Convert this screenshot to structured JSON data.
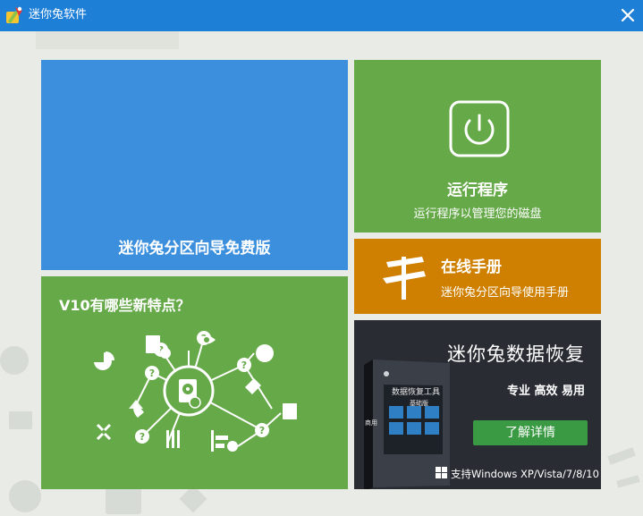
{
  "window": {
    "title": "迷你兔软件",
    "icon": "app-logo-icon",
    "close_icon": "close-icon"
  },
  "tiles": {
    "partition_wizard": {
      "title": "迷你兔分区向导免费版"
    },
    "features": {
      "title": "V10有哪些新特点？"
    },
    "run_program": {
      "title": "运行程序",
      "subtitle": "运行程序以管理您的磁盘",
      "icon": "power-icon"
    },
    "manual": {
      "title": "在线手册",
      "subtitle": "迷你兔分区向导使用手册",
      "icon": "signpost-icon"
    },
    "promo": {
      "title": "迷你兔数据恢复",
      "tags": "专业 高效 易用",
      "button_label": "了解详情",
      "support_text": "支持Windows XP/Vista/7/8/10",
      "box_label": "数据恢复工具",
      "box_edition": "基础版",
      "box_side": "商用"
    }
  },
  "colors": {
    "titlebar": "#1e7fd7",
    "blue_tile": "#3b8fdd",
    "green_tile": "#66a949",
    "orange_tile": "#cf8000",
    "promo_bg": "#2a2c33",
    "promo_button": "#3a9a43"
  }
}
